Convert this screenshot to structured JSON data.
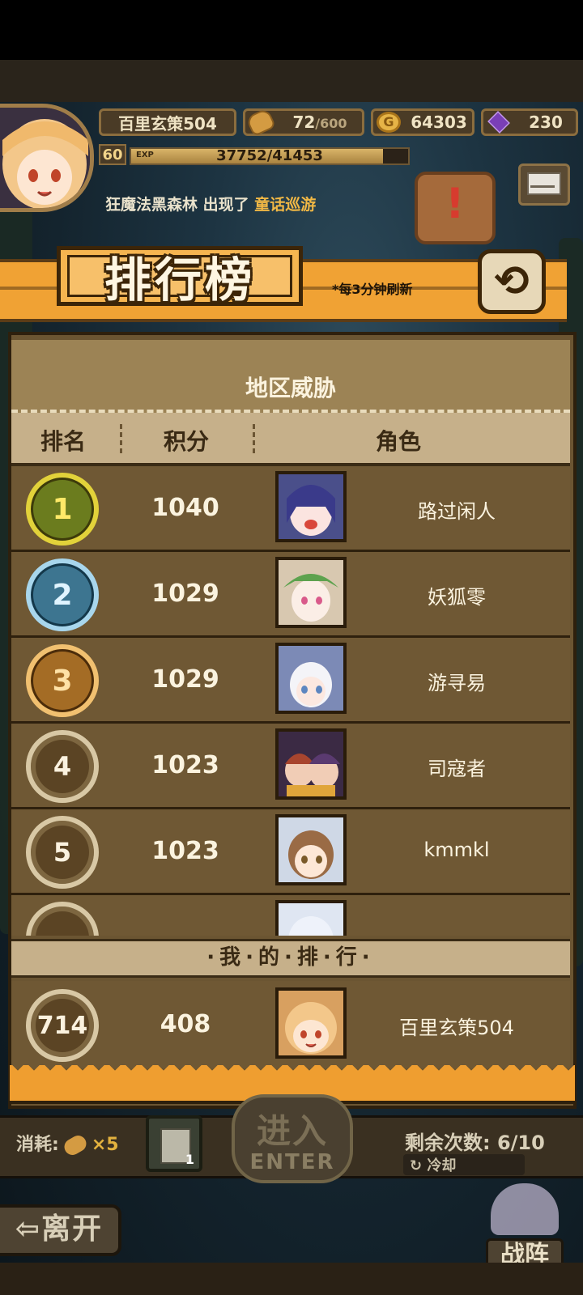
{
  "hud": {
    "player_name": "百里玄策504",
    "stamina": "72",
    "stamina_max": "/600",
    "gold": "64303",
    "gems": "230",
    "level": "60",
    "exp_label": "EXP",
    "exp_text": "37752/41453",
    "exp_progress": 0.91
  },
  "ticker": {
    "text": "狂魔法黑森林 出现了 ",
    "highlight": "童话巡游"
  },
  "banner": {
    "title": "排行榜",
    "refresh_note": "*每3分钟刷新",
    "back_icon": "⟲"
  },
  "panel": {
    "title": "地区威胁",
    "columns": {
      "rank": "排名",
      "score": "积分",
      "role": "角色"
    }
  },
  "rows": [
    {
      "rank": "1",
      "score": "1040",
      "name": "路过闲人"
    },
    {
      "rank": "2",
      "score": "1029",
      "name": "妖狐零"
    },
    {
      "rank": "3",
      "score": "1029",
      "name": "游寻易"
    },
    {
      "rank": "4",
      "score": "1023",
      "name": "司寇者"
    },
    {
      "rank": "5",
      "score": "1023",
      "name": "kmmkl"
    }
  ],
  "mine": {
    "header": "·我·的·排·行·",
    "rank": "714",
    "score": "408",
    "name": "百里玄策504"
  },
  "bottom": {
    "cost_label": "消耗:",
    "cost_mult": "×5",
    "map_count": "1",
    "enter_zh": "进入",
    "enter_en": "ENTER",
    "remain": "剩余次数: 6/10",
    "cooldown": "冷却",
    "leave": "⇦离开",
    "formation": "战阵"
  },
  "colors": {
    "accent": "#f0a234",
    "panel": "#6f5834",
    "header": "#c6b08a"
  }
}
